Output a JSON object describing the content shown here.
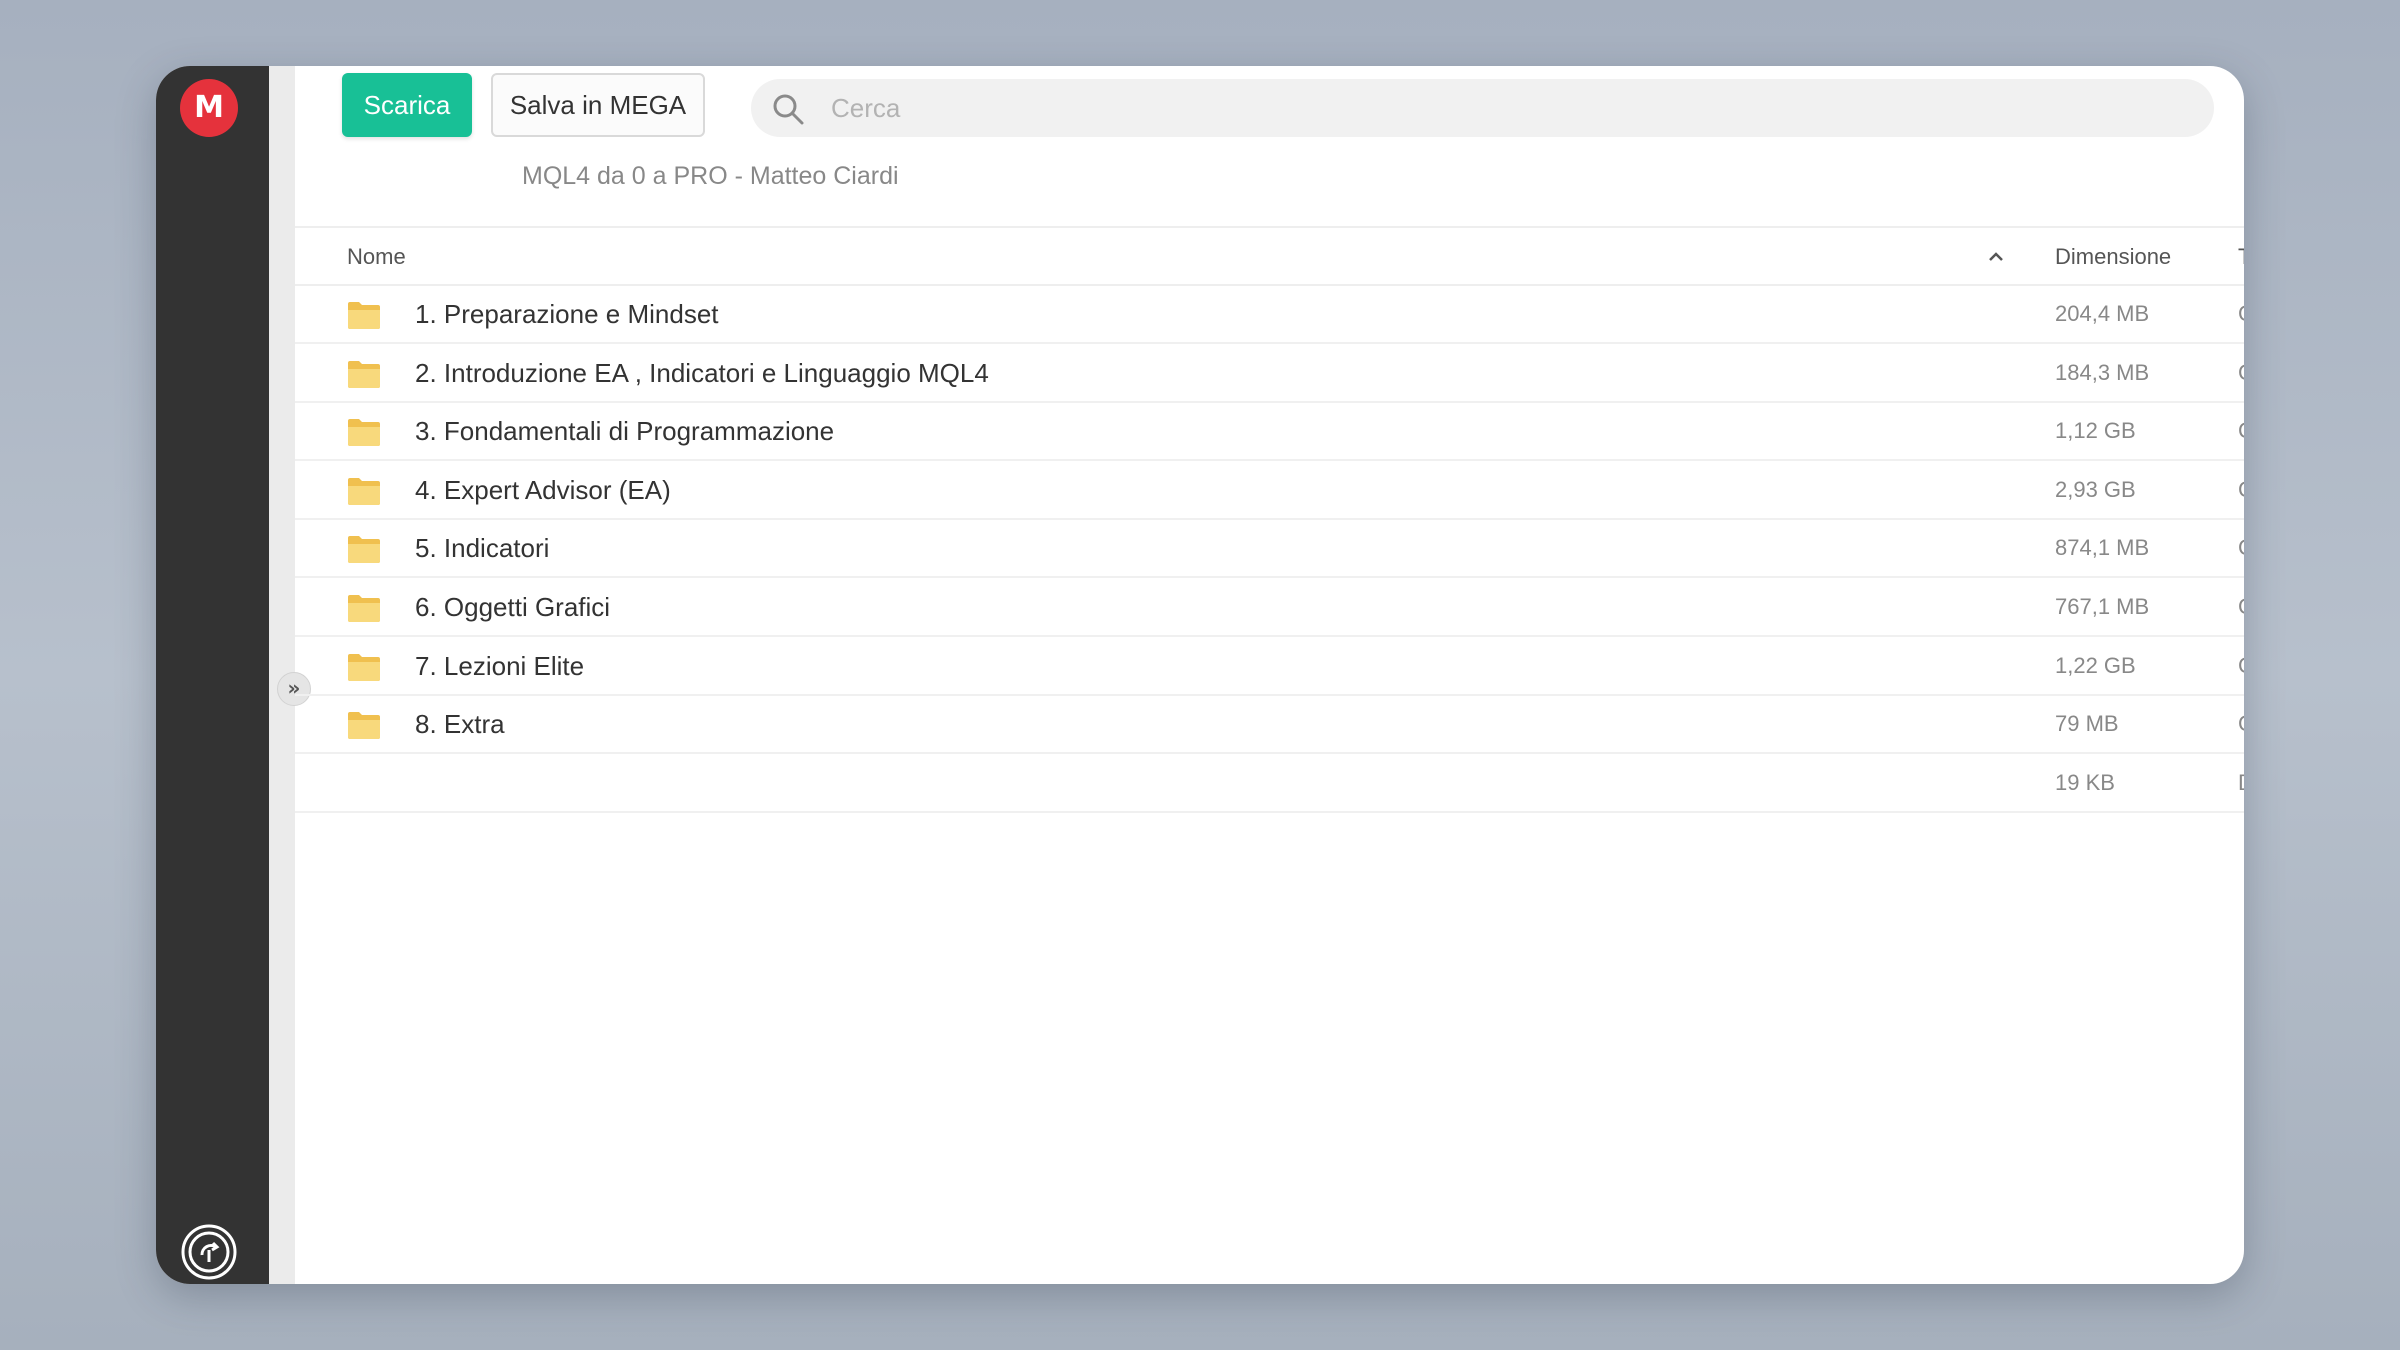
{
  "app": {
    "logo_letter": "M"
  },
  "toolbar": {
    "download_label": "Scarica",
    "save_label": "Salva in MEGA"
  },
  "search": {
    "placeholder": "Cerca"
  },
  "breadcrumb": "MQL4 da 0 a PRO - Matteo Ciardi",
  "table": {
    "headers": {
      "name": "Nome",
      "size": "Dimensione",
      "type": "Tipo"
    },
    "sort": "name-ascending",
    "rows": [
      {
        "name": "1. Preparazione e Mindset",
        "size": "204,4 MB",
        "type": "Cartella",
        "icon": "folder-icon"
      },
      {
        "name": "2. Introduzione EA , Indicatori e Linguaggio MQL4",
        "size": "184,3 MB",
        "type": "Cartella",
        "icon": "folder-icon"
      },
      {
        "name": "3. Fondamentali di Programmazione",
        "size": "1,12 GB",
        "type": "Cartella",
        "icon": "folder-icon"
      },
      {
        "name": "4. Expert Advisor (EA)",
        "size": "2,93 GB",
        "type": "Cartella",
        "icon": "folder-icon"
      },
      {
        "name": "5. Indicatori",
        "size": "874,1 MB",
        "type": "Cartella",
        "icon": "folder-icon"
      },
      {
        "name": "6. Oggetti Grafici",
        "size": "767,1 MB",
        "type": "Cartella",
        "icon": "folder-icon"
      },
      {
        "name": "7. Lezioni Elite",
        "size": "1,22 GB",
        "type": "Cartella",
        "icon": "folder-icon"
      },
      {
        "name": "8. Extra",
        "size": "79 MB",
        "type": "Cartella",
        "icon": "folder-icon"
      },
      {
        "name": "",
        "size": "19 KB",
        "type": "Documento PDF",
        "icon": ""
      }
    ]
  },
  "colors": {
    "sidebar": "#333333",
    "brand_red": "#e5323c",
    "download_green": "#18c096",
    "folder_yellow": "#f5cd62"
  }
}
